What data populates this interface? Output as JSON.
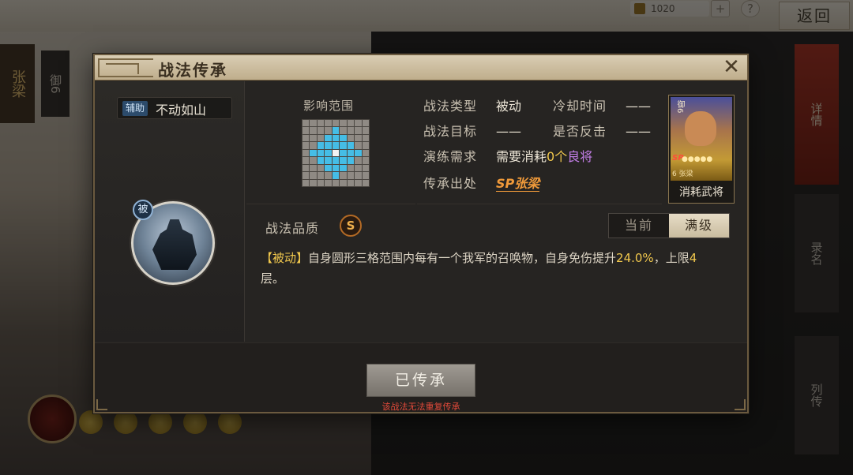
{
  "background": {
    "resource_value": "1020",
    "plus_glyph": "+",
    "help_glyph": "?",
    "back_label": "返回",
    "side_tabs": [
      "详情",
      "录名",
      "列传"
    ],
    "hero_name": "张梁",
    "hero_rank": "御6"
  },
  "dialog": {
    "title": "战法传承",
    "close_glyph": "✕",
    "role_tag": "辅助",
    "skill_name": "不动如山",
    "passive_badge": "被",
    "range_label": "影响范围",
    "info": {
      "type_key": "战法类型",
      "type_val": "被动",
      "cooldown_key": "冷却时间",
      "cooldown_val": "——",
      "target_key": "战法目标",
      "target_val": "——",
      "counter_key": "是否反击",
      "counter_val": "——",
      "req_key": "演练需求",
      "req_pre": "需要消耗",
      "req_count": "0个",
      "req_item": "良将",
      "source_key": "传承出处",
      "source_val": "SP张梁"
    },
    "hero_card": {
      "rank": "御6",
      "sp": "SP",
      "stars": "●●●●●",
      "meta": "6 张梁",
      "caption": "消耗武将"
    },
    "quality_label": "战法品质",
    "quality_grade": "S",
    "level_tabs": [
      "当前",
      "满级"
    ],
    "description": {
      "tag": "【被动】",
      "text1": "自身圆形三格范围内每有一个我军的召唤物，自身免伤提升",
      "num1": "24.0%",
      "text2": "，上限",
      "num2": "4",
      "text3": "层。"
    },
    "inherit_button": "已传承",
    "inherit_note": "该战法无法重复传承"
  },
  "colors": {
    "accent_gold": "#f1c84d",
    "range_blue": "#45bde6",
    "warning_red": "#e24a3a",
    "rare_purple": "#c37ee8"
  }
}
